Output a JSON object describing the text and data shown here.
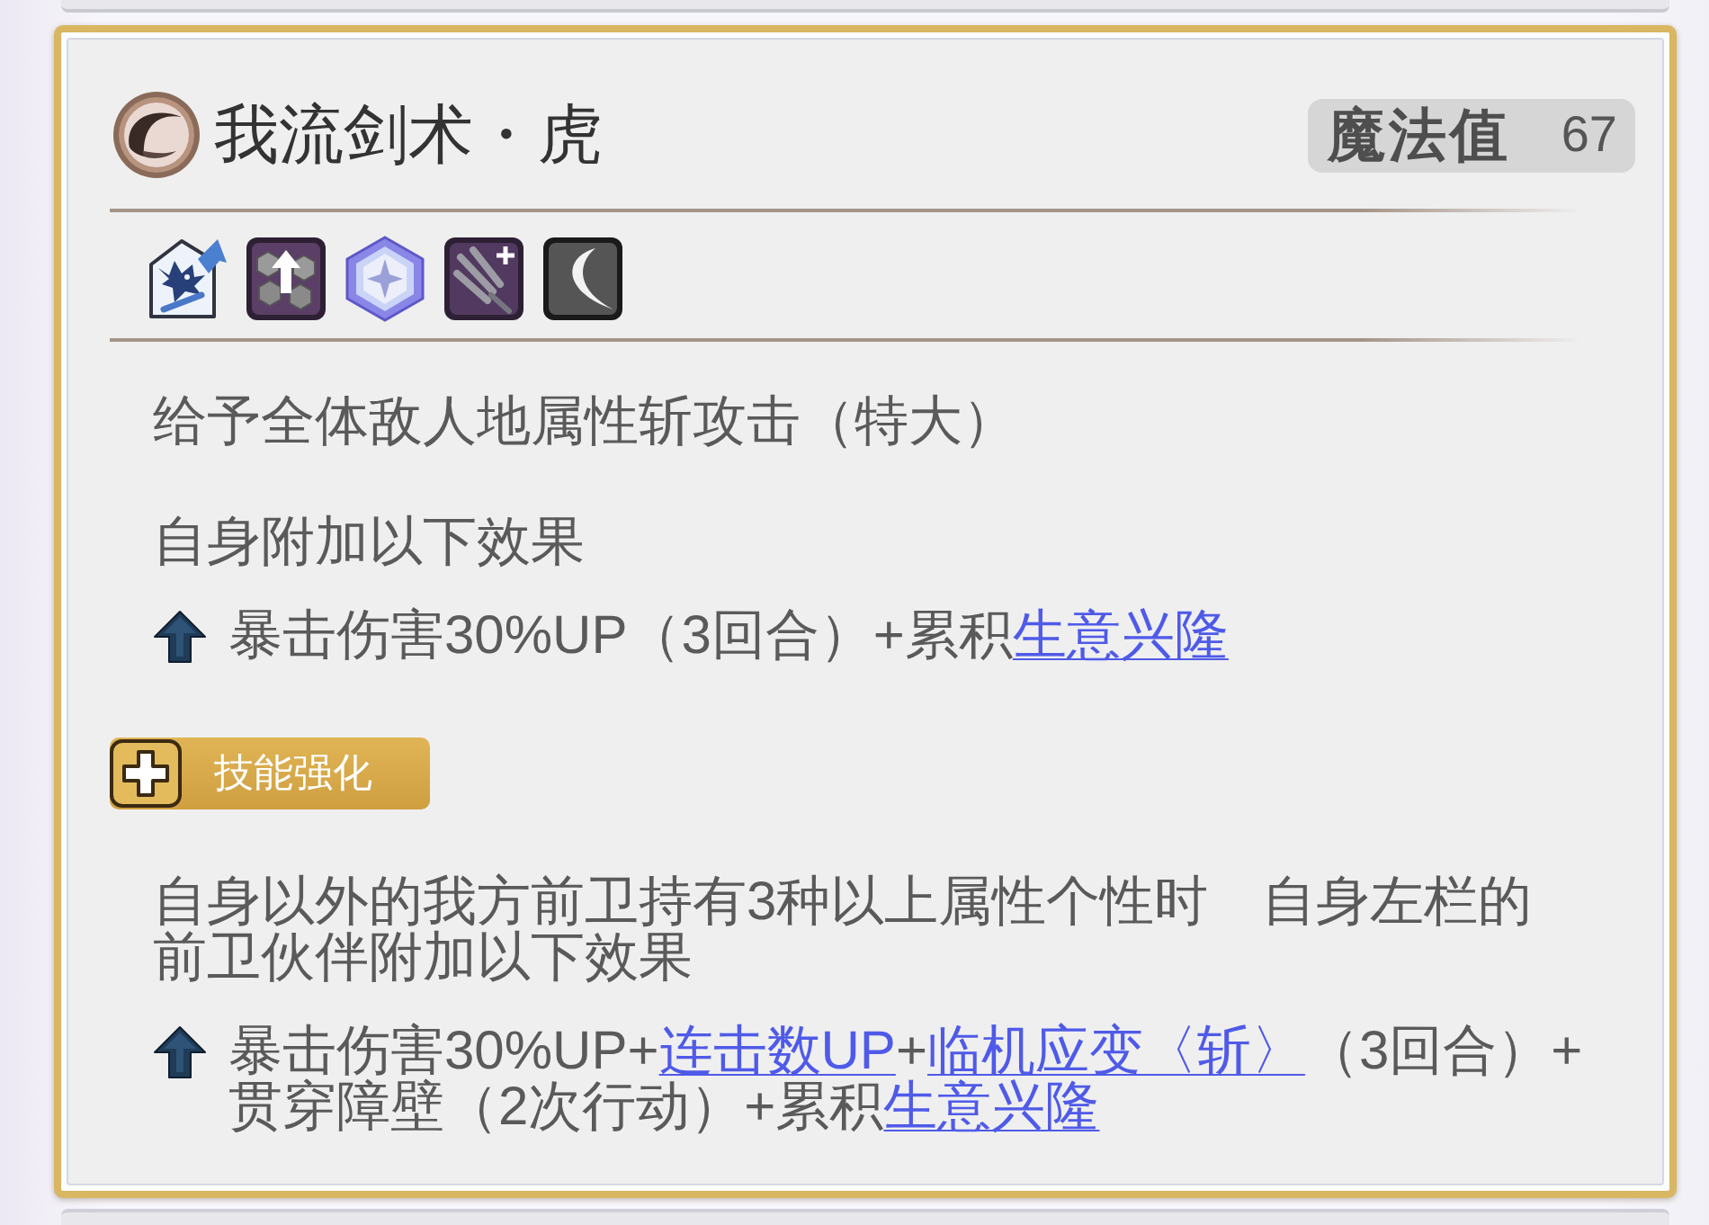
{
  "skill": {
    "name": "我流剑术・虎",
    "cost_label": "魔法值",
    "cost": "67"
  },
  "icons": [
    {
      "kind": "dragon"
    },
    {
      "kind": "hexagons"
    },
    {
      "kind": "gem"
    },
    {
      "kind": "claw"
    },
    {
      "kind": "slash"
    }
  ],
  "blocks": [
    {
      "kind": "text",
      "segments": [
        {
          "kind": "text",
          "text": "给予全体敌人地属性斩攻击（特大）"
        }
      ]
    },
    {
      "kind": "text",
      "segments": [
        {
          "kind": "text",
          "text": "自身附加以下效果"
        }
      ]
    },
    {
      "kind": "buff",
      "segments": [
        {
          "kind": "text",
          "text": "暴击伤害30%UP（3回合）+累积"
        },
        {
          "kind": "link",
          "text": "生意兴隆"
        }
      ]
    },
    {
      "kind": "tag",
      "label": "技能强化"
    },
    {
      "kind": "text",
      "segments": [
        {
          "kind": "text",
          "text": "自身以外的我方前卫持有3种以上属性个性时　自身左栏的前卫伙伴附加以下效果"
        }
      ]
    },
    {
      "kind": "buff",
      "segments": [
        {
          "kind": "text",
          "text": "暴击伤害30%UP+"
        },
        {
          "kind": "link",
          "text": "连击数UP"
        },
        {
          "kind": "text",
          "text": "+"
        },
        {
          "kind": "link",
          "text": "临机应变〈斩〉"
        },
        {
          "kind": "text",
          "text": "（3回合）+贯穿障壁（2次行动）+累积"
        },
        {
          "kind": "link",
          "text": "生意兴隆"
        }
      ]
    }
  ]
}
